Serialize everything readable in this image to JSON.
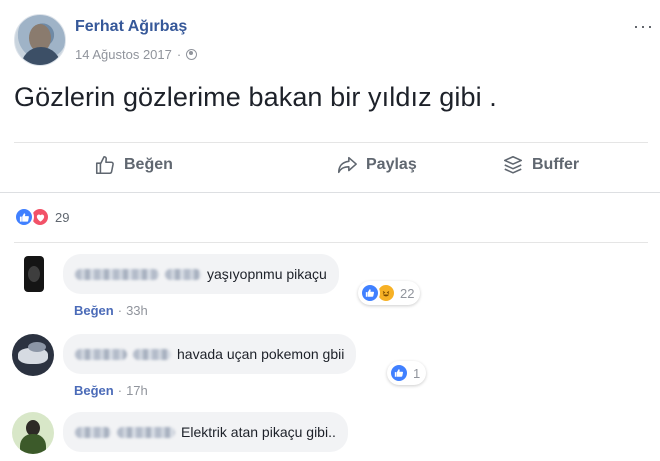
{
  "post": {
    "author": "Ferhat Ağırbaş",
    "date": "14 Ağustos 2017",
    "separator": "·",
    "privacy_icon": "globe-icon",
    "more_icon": "ellipsis-icon",
    "more_label": "···",
    "text": "Gözlerin gözlerime bakan bir yıldız gibi ."
  },
  "actions": {
    "like_label": "Beğen",
    "share_label": "Paylaş",
    "buffer_label": "Buffer"
  },
  "reactions": {
    "types": [
      "like",
      "love"
    ],
    "count": "29",
    "colors": {
      "like": "#4080ff",
      "love": "#f25268",
      "haha": "#f7b125"
    }
  },
  "comments": [
    {
      "text": "yaşıyopnmu pikaçu",
      "reactions": [
        "like",
        "haha"
      ],
      "reaction_count": "22",
      "like_label": "Beğen",
      "time": "33h",
      "separator": "·"
    },
    {
      "text": "havada uçan pokemon gbii",
      "reactions": [
        "like"
      ],
      "reaction_count": "1",
      "like_label": "Beğen",
      "time": "17h",
      "separator": "·"
    },
    {
      "text": "Elektrik atan pikaçu gibi.."
    }
  ],
  "colors": {
    "author_link": "#365899",
    "muted": "#90949c",
    "bubble": "#f2f3f5"
  }
}
